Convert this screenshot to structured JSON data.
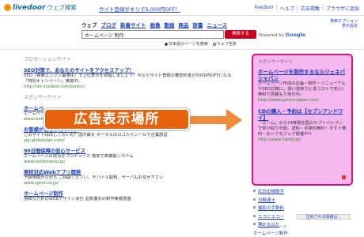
{
  "header": {
    "logo_brand": "livedoor",
    "logo_service": "ウェブ検索",
    "promo": "サイト登録がキリで5,000円OFF！",
    "links": [
      "livedoor",
      "ヘルプ",
      "広告掲載",
      "ブラウザに追加"
    ]
  },
  "tabs": [
    "ウェブ",
    "ブログ",
    "新着サイト",
    "画像",
    "動画",
    "商品",
    "辞書",
    "ニュース"
  ],
  "settings": {
    "line1": "検索オプション",
    "line2": "表示設定"
  },
  "search": {
    "value": "ホームページ 制作",
    "button": "検索する",
    "powered_prefix": "Powered by",
    "powered_brand": "Google"
  },
  "radios": [
    "日本語のページを検索",
    "ウェブ全体"
  ],
  "left": {
    "promo_label": "プロモーションサイト",
    "promo": {
      "title": "SEO対策で、あなたのサイトをアクセスアップ！",
      "desc": "SEO（検索エンジン最適化）で上位表示を目指しましょう！今ならサイト登録の審査料金が5000円OFFになる「特別キャンペーン」実施中。",
      "url": "http://dir.livedoor.com/jentry/"
    },
    "spon_label": "スポンサーサイト",
    "results": [
      {
        "title": "ホームペ",
        "desc": "ホームペー",
        "url": "www.webs"
      },
      {
        "title": "お客様が安心するサイト",
        "desc": "このサイトはほしくないの？国内最大 ポータルのロゴ入りシールで企業認証",
        "url": "yjp.globalsign.com/"
      },
      {
        "title": "90日間保障の安心サービス",
        "desc": "ホームページの成功をプロデュース 格安で高機能システム",
        "url": "www.netdehanjo.jp/"
      },
      {
        "title": "楽校対応Webアプリ開発",
        "desc": "予算規模からがら ご相談ください。モバイル開発、サーバもお任せ下さい",
        "url": "www.ignet.co.jp/"
      },
      {
        "title": "ホームページ制作",
        "desc": "信頼な方針のWEBデザイン会社 品質優先の制作実績豊富",
        "url": ""
      }
    ]
  },
  "callout": "広告表示場所",
  "spon_box": {
    "label": "スポンサーサイト",
    "ads": [
      {
        "title": "ホームページを制作するならジェネパシャパン",
        "desc": "ホームページ作成の企画・制作・リニューアルやSEO対策に。高い技術力と低コストで安心！無料で見積もり受付中。",
        "url": "http://www.geneu-japan.com"
      },
      {
        "title": "CDの購入・予約は【セブンアンドワイ】",
        "desc": "「ホーム」から24時間全国のセブンイレブンで受け取り可能。送料・手数料無料！今すぐ無料・おトクなフェア開催中!!",
        "url": "http://www.7andy.jp/"
      }
    ]
  },
  "right_list": [
    "紅白出場歌手",
    "日韓運士",
    "撮影の手数料",
    "エコとエコー",
    "静かなつり"
  ],
  "more_btn": "注目される順番は…",
  "word_label": "急上昇ワード",
  "word_sub": "ホームページ制作"
}
